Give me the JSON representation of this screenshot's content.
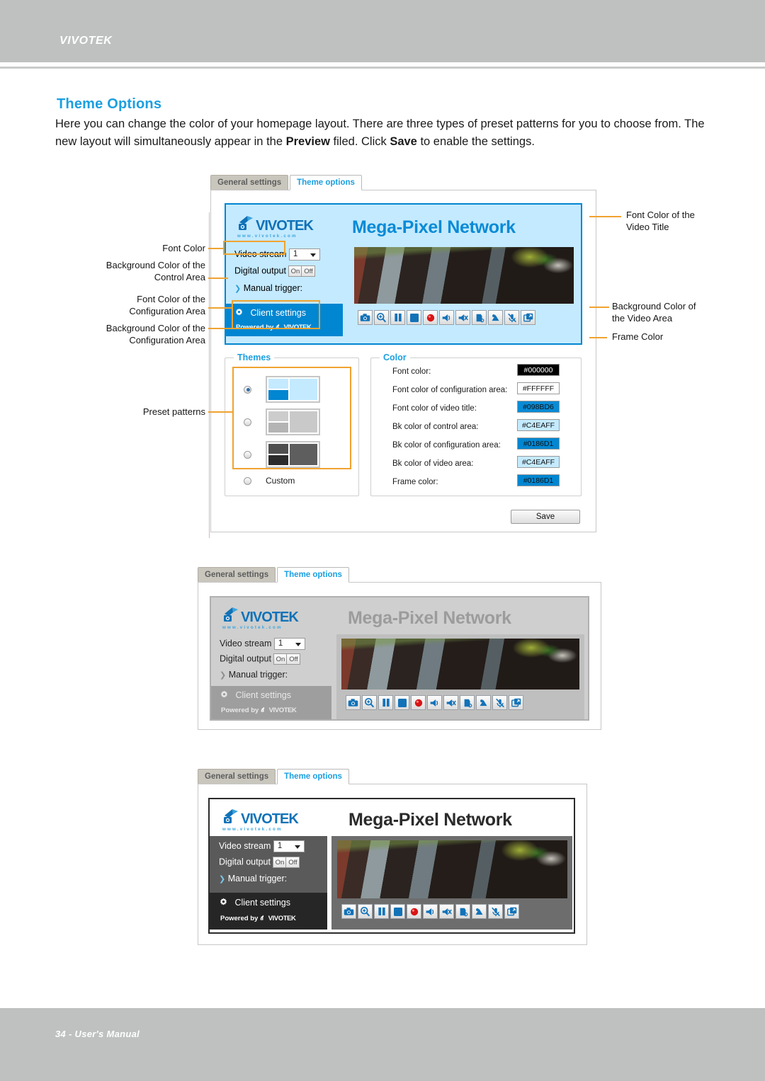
{
  "header": {
    "brand": "VIVOTEK"
  },
  "footer": {
    "folio": "34 - User's Manual"
  },
  "doc": {
    "section_title": "Theme Options",
    "intro_part1": "Here you can change the color of your homepage layout. There are three types of preset patterns for you to choose from. The new layout will simultaneously appear in the ",
    "intro_bold1": "Preview",
    "intro_part2": " filed. Click ",
    "intro_bold2": "Save",
    "intro_part3": " to enable the settings."
  },
  "tabs": {
    "general_settings": "General settings",
    "theme_options": "Theme options"
  },
  "preview": {
    "video_title": "Mega-Pixel Network",
    "logo_wordmark": "VIVOTEK",
    "logo_url": "www.vivotek.com",
    "video_stream_label": "Video stream",
    "video_stream_value": "1",
    "digital_output_label": "Digital output",
    "digital_output_on": "On",
    "digital_output_off": "Off",
    "manual_trigger_label": "Manual trigger:",
    "client_settings_label": "Client settings",
    "powered_by_label": "Powered by",
    "powered_by_brand": "VIVOTEK",
    "controls": [
      "snapshot-icon",
      "digital-zoom-icon",
      "pause-icon",
      "stop-icon",
      "record-icon",
      "volume-icon",
      "mute-icon",
      "talk-icon",
      "listen-icon",
      "mic-off-icon",
      "fullscreen-icon"
    ]
  },
  "themes_panel": {
    "legend": "Themes",
    "options": [
      {
        "name": "preset-blue",
        "selected": true,
        "colors": {
          "top": "#c4eaff",
          "bottom": "#0186d1",
          "right": "#c4eaff",
          "frame": "#c6c6c6"
        }
      },
      {
        "name": "preset-gray",
        "selected": false,
        "colors": {
          "top": "#cccccc",
          "bottom": "#b4b4b4",
          "right": "#c9c9c9",
          "frame": "#c6c6c6"
        }
      },
      {
        "name": "preset-dark",
        "selected": false,
        "colors": {
          "top": "#4f4f4f",
          "bottom": "#2b2b2b",
          "right": "#5e5e5e",
          "frame": "#c6c6c6"
        }
      }
    ],
    "custom_label": "Custom",
    "custom_selected": false
  },
  "color_panel": {
    "legend": "Color",
    "rows": [
      {
        "label": "Font color:",
        "value": "#000000",
        "bg": "#000000",
        "fg": "#ffffff"
      },
      {
        "label": "Font color of configuration area:",
        "value": "#FFFFFF",
        "bg": "#ffffff",
        "fg": "#111111"
      },
      {
        "label": "Font color of video title:",
        "value": "#098BD6",
        "bg": "#098bd6",
        "fg": "#111111"
      },
      {
        "label": "Bk color of control area:",
        "value": "#C4EAFF",
        "bg": "#c4eaff",
        "fg": "#111111"
      },
      {
        "label": "Bk color of configuration area:",
        "value": "#0186D1",
        "bg": "#0186d1",
        "fg": "#111111"
      },
      {
        "label": "Bk color of video area:",
        "value": "#C4EAFF",
        "bg": "#c4eaff",
        "fg": "#111111"
      },
      {
        "label": "Frame color:",
        "value": "#0186D1",
        "bg": "#0186d1",
        "fg": "#111111"
      }
    ]
  },
  "save_button": {
    "label": "Save"
  },
  "callouts": {
    "font_color": "Font Color",
    "bk_control_area": "Background Color of the\nControl Area",
    "font_config_area": "Font Color of the\nConfiguration Area",
    "bk_config_area": "Background Color of the\nConfiguration Area",
    "preset_patterns": "Preset patterns",
    "font_video_title": "Font Color of the\nVideo Title",
    "bk_video_area": "Background Color of\nthe Video Area",
    "frame_color": "Frame Color"
  },
  "theme_variants": {
    "blue": {
      "title_color": "#098bd6",
      "control_bg": "#c4eaff",
      "config_bg": "#0186d1",
      "config_fg": "#ffffff",
      "video_bg": "#c4eaff",
      "frame_color": "#0186d1",
      "font_color": "#000000"
    },
    "gray": {
      "title_color": "#9c9c9c",
      "control_bg": "#cfcfcf",
      "config_bg": "#9e9e9e",
      "config_fg": "#e8e8e8",
      "video_bg": "#bfbfbf",
      "frame_color": "#b0b0b0",
      "font_color": "#222222"
    },
    "dark": {
      "title_color": "#2b2b2b",
      "control_bg": "#5a5a5a",
      "config_bg": "#262626",
      "config_fg": "#ffffff",
      "video_bg": "#6d6d6d",
      "frame_color": "#2b2b2b",
      "font_color": "#ffffff"
    }
  }
}
